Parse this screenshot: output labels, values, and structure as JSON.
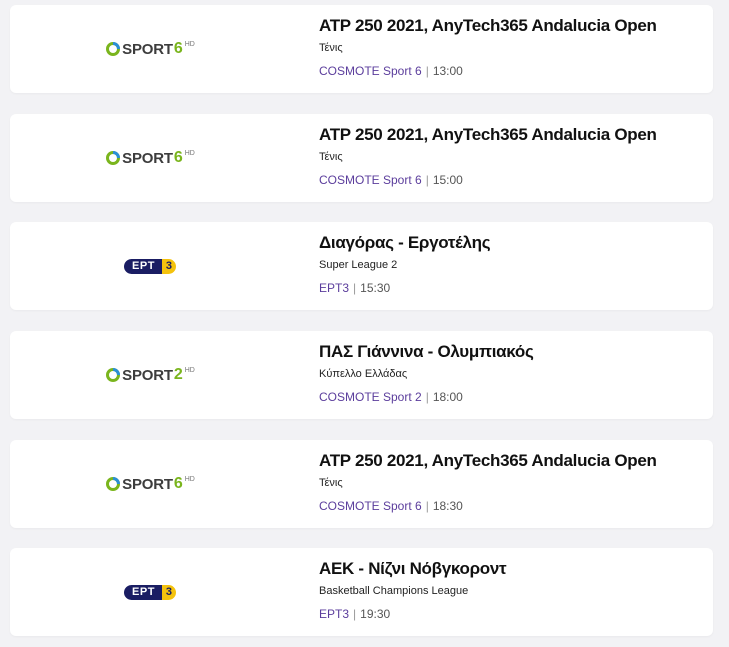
{
  "colors": {
    "page_bg": "#f2f2f5",
    "card_bg": "#ffffff",
    "channel_link": "#5b3d9c",
    "sport_green": "#7ab51d",
    "ert_navy": "#1a1d63",
    "ert_yellow": "#f4c20d"
  },
  "listings": [
    {
      "logo_type": "sport",
      "logo_word": "SPORT",
      "logo_number": "6",
      "logo_hd": "HD",
      "title": "ATP 250 2021, AnyTech365 Andalucia Open",
      "category": "Τένις",
      "channel": "COSMOTE Sport 6",
      "separator": "|",
      "time": "13:00"
    },
    {
      "logo_type": "sport",
      "logo_word": "SPORT",
      "logo_number": "6",
      "logo_hd": "HD",
      "title": "ATP 250 2021, AnyTech365 Andalucia Open",
      "category": "Τένις",
      "channel": "COSMOTE Sport 6",
      "separator": "|",
      "time": "15:00"
    },
    {
      "logo_type": "ert",
      "logo_word": "ΕΡΤ",
      "logo_number": "3",
      "logo_hd": "",
      "title": "Διαγόρας - Εργοτέλης",
      "category": "Super League 2",
      "channel": "ΕΡΤ3",
      "separator": "|",
      "time": "15:30"
    },
    {
      "logo_type": "sport",
      "logo_word": "SPORT",
      "logo_number": "2",
      "logo_hd": "HD",
      "title": "ΠΑΣ Γιάννινα - Ολυμπιακός",
      "category": "Κύπελλο Ελλάδας",
      "channel": "COSMOTE Sport 2",
      "separator": "|",
      "time": "18:00"
    },
    {
      "logo_type": "sport",
      "logo_word": "SPORT",
      "logo_number": "6",
      "logo_hd": "HD",
      "title": "ATP 250 2021, AnyTech365 Andalucia Open",
      "category": "Τένις",
      "channel": "COSMOTE Sport 6",
      "separator": "|",
      "time": "18:30"
    },
    {
      "logo_type": "ert",
      "logo_word": "ΕΡΤ",
      "logo_number": "3",
      "logo_hd": "",
      "title": "ΑΕΚ - Νίζνι Νόβγκοροντ",
      "category": "Basketball Champions League",
      "channel": "ΕΡΤ3",
      "separator": "|",
      "time": "19:30"
    }
  ]
}
